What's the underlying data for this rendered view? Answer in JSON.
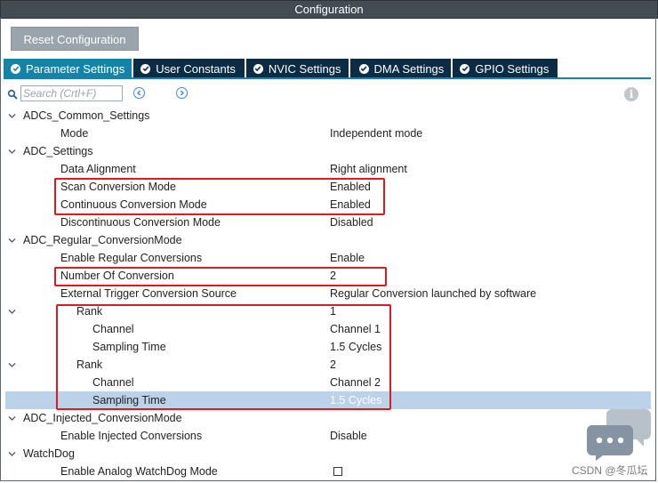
{
  "window": {
    "title": "Configuration"
  },
  "toolbar": {
    "reset_label": "Reset Configuration"
  },
  "tabs": [
    {
      "label": "Parameter Settings",
      "active": true
    },
    {
      "label": "User Constants",
      "active": false
    },
    {
      "label": "NVIC Settings",
      "active": false
    },
    {
      "label": "DMA Settings",
      "active": false
    },
    {
      "label": "GPIO Settings",
      "active": false
    }
  ],
  "search": {
    "placeholder": "Search (Crtl+F)"
  },
  "tree": {
    "adcs_common": {
      "label": "ADCs_Common_Settings",
      "mode_label": "Mode",
      "mode_value": "Independent mode"
    },
    "adc_settings": {
      "label": "ADC_Settings",
      "data_alignment_label": "Data Alignment",
      "data_alignment_value": "Right alignment",
      "scan_label": "Scan Conversion Mode",
      "scan_value": "Enabled",
      "continuous_label": "Continuous Conversion Mode",
      "continuous_value": "Enabled",
      "discontinuous_label": "Discontinuous Conversion Mode",
      "discontinuous_value": "Disabled"
    },
    "regular": {
      "label": "ADC_Regular_ConversionMode",
      "enable_label": "Enable Regular Conversions",
      "enable_value": "Enable",
      "number_label": "Number Of Conversion",
      "number_value": "2",
      "trigger_label": "External Trigger Conversion Source",
      "trigger_value": "Regular Conversion launched by software",
      "ranks": [
        {
          "rank_label": "Rank",
          "rank_value": "1",
          "channel_label": "Channel",
          "channel_value": "Channel 1",
          "sampling_label": "Sampling Time",
          "sampling_value": "1.5 Cycles"
        },
        {
          "rank_label": "Rank",
          "rank_value": "2",
          "channel_label": "Channel",
          "channel_value": "Channel 2",
          "sampling_label": "Sampling Time",
          "sampling_value": "1.5 Cycles"
        }
      ]
    },
    "injected": {
      "label": "ADC_Injected_ConversionMode",
      "enable_label": "Enable Injected Conversions",
      "enable_value": "Disable"
    },
    "watchdog": {
      "label": "WatchDog",
      "enable_label": "Enable Analog WatchDog Mode",
      "enable_checked": false
    }
  },
  "watermark": "CSDN @冬瓜坛",
  "colors": {
    "title_bg": "#434b53",
    "tab_active": "#1583a7",
    "tab_inactive": "#0b2c44",
    "highlight": "#e0191f",
    "selection": "#bcd2e8"
  }
}
